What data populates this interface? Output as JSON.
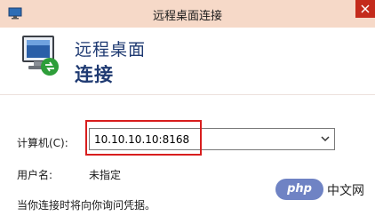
{
  "window": {
    "title": "远程桌面连接",
    "app_icon": "monitor-icon",
    "close_icon": "close-icon",
    "titlebar_color": "#f6d9c8",
    "close_color": "#c42b1c"
  },
  "header": {
    "line1": "远程桌面",
    "line2": "连接",
    "text_color": "#1f3a72",
    "icon": "remote-desktop-monitor-icon"
  },
  "form": {
    "computer_label": "计算机(C):",
    "computer_value": "10.10.10.10:8168",
    "dropdown_icon": "chevron-down-icon",
    "user_label": "用户名:",
    "user_value": "未指定",
    "info_text": "当你连接时将向你询问凭据。"
  },
  "annotation": {
    "highlight_color": "#d81e1e"
  },
  "watermark": {
    "pill_text": "php",
    "text": "中文网",
    "pill_color": "#6f83c4"
  }
}
